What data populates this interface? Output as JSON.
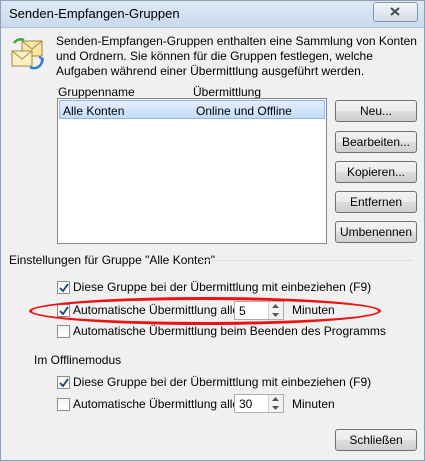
{
  "window": {
    "title": "Senden-Empfangen-Gruppen",
    "description": "Senden-Empfangen-Gruppen enthalten eine Sammlung von Konten und Ordnern. Sie können für die Gruppen festlegen, welche Aufgaben während einer Übermittlung ausgeführt werden."
  },
  "groups_table": {
    "columns": [
      "Gruppenname",
      "Übermittlung"
    ],
    "rows": [
      {
        "name": "Alle Konten",
        "transfer": "Online und Offline",
        "selected": true
      }
    ]
  },
  "buttons": {
    "new": "Neu...",
    "edit": "Bearbeiten...",
    "copy": "Kopieren...",
    "remove": "Entfernen",
    "rename": "Umbenennen",
    "close": "Schließen"
  },
  "group_settings": {
    "header": "Einstellungen für Gruppe \"Alle Konten\"",
    "include_label": "Diese Gruppe bei der Übermittlung mit einbeziehen (F9)",
    "include_checked": true,
    "auto_label": "Automatische Übermittlung alle",
    "auto_checked": true,
    "auto_minutes": "5",
    "minutes_label": "Minuten",
    "on_exit_label": "Automatische Übermittlung beim Beenden des Programms",
    "on_exit_checked": false
  },
  "offline_mode": {
    "header": "Im Offlinemodus",
    "include_label": "Diese Gruppe bei der Übermittlung mit einbeziehen (F9)",
    "include_checked": true,
    "auto_label": "Automatische Übermittlung alle",
    "auto_checked": false,
    "auto_minutes": "30",
    "minutes_label": "Minuten"
  },
  "colors": {
    "annotation": "#ee1111",
    "selection": "#c4dcf8"
  },
  "icons": [
    "send-receive-icon",
    "close-icon",
    "checkmark-icon",
    "spin-up-icon",
    "spin-down-icon"
  ]
}
